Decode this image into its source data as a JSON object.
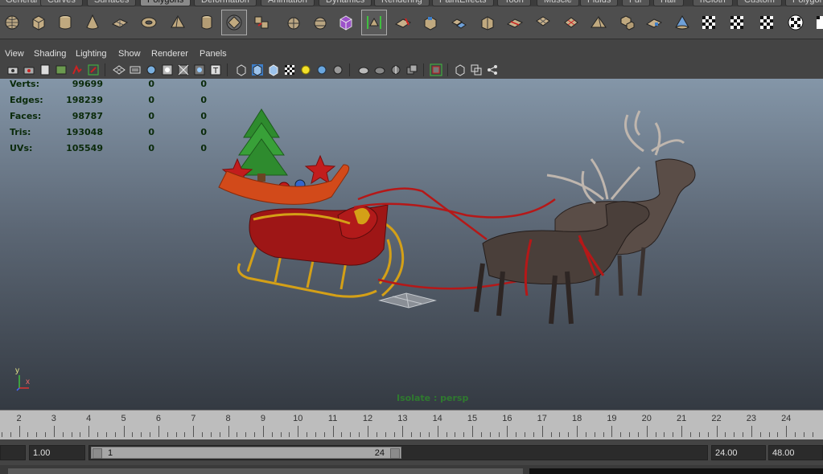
{
  "shelf_tabs": [
    {
      "label": "General",
      "active": false
    },
    {
      "label": "Curves",
      "active": false
    },
    {
      "label": "Surfaces",
      "active": false
    },
    {
      "label": "Polygons",
      "active": true
    },
    {
      "label": "Deformation",
      "active": false
    },
    {
      "label": "Animation",
      "active": false
    },
    {
      "label": "Dynamics",
      "active": false
    },
    {
      "label": "Rendering",
      "active": false
    },
    {
      "label": "PaintEffects",
      "active": false
    },
    {
      "label": "Toon",
      "active": false
    },
    {
      "label": "Muscle",
      "active": false
    },
    {
      "label": "Fluids",
      "active": false
    },
    {
      "label": "Fur",
      "active": false
    },
    {
      "label": "Hair",
      "active": false
    },
    {
      "label": "nCloth",
      "active": false
    },
    {
      "label": "Custom",
      "active": false
    },
    {
      "label": "Polygons",
      "active": false
    }
  ],
  "shelf_icons": [
    "poly-sphere-icon",
    "poly-cube-icon",
    "poly-cylinder-icon",
    "poly-cone-icon",
    "poly-plane-icon",
    "poly-torus-icon",
    "poly-pyramid-icon",
    "poly-pipe-icon",
    "smooth-proxy-icon",
    "combine-icon",
    "separate-icon",
    "extract-icon",
    "mirror-icon",
    "selected-object-icon",
    "bevel-icon",
    "extrude-icon",
    "bridge-icon",
    "append-icon",
    "split-polygon-icon",
    "insert-edge-loop-icon",
    "offset-edge-loop-icon",
    "sculpt-icon",
    "smooth-icon",
    "triangulate-icon",
    "quadrangulate-icon",
    "reduce-icon",
    "cleanup-icon",
    "fill-hole-icon",
    "planar-mapping-icon",
    "checker-uv-1-icon",
    "checker-uv-2-icon",
    "checker-uv-3-icon",
    "checker-uv-4-icon"
  ],
  "menu": [
    "View",
    "Shading",
    "Lighting",
    "Show",
    "Renderer",
    "Panels"
  ],
  "toolbar_icons": [
    "camera-select-icon",
    "camera-attr-icon",
    "bookmark-icon",
    "image-plane-icon",
    "two-d-pan-icon",
    "grease-pencil-icon",
    "grid-icon",
    "film-gate-icon",
    "resolution-gate-icon",
    "gate-mask-icon",
    "field-chart-icon",
    "safe-action-icon",
    "safe-title-icon",
    "wireframe-icon",
    "smooth-shade-icon",
    "wireframe-on-shaded-icon",
    "textured-icon",
    "use-all-lights-icon",
    "shadows-icon",
    "ambient-occlusion-icon",
    "xray-icon",
    "xray-joints-icon",
    "xray-components-icon",
    "isolate-select-icon",
    "backface-icon",
    "default-material-icon",
    "symmetry-icon"
  ],
  "hud": [
    {
      "label": "Verts:",
      "v1": "99699",
      "v2": "0",
      "v3": "0"
    },
    {
      "label": "Edges:",
      "v1": "198239",
      "v2": "0",
      "v3": "0"
    },
    {
      "label": "Faces:",
      "v1": "98787",
      "v2": "0",
      "v3": "0"
    },
    {
      "label": "Tris:",
      "v1": "193048",
      "v2": "0",
      "v3": "0"
    },
    {
      "label": "UVs:",
      "v1": "105549",
      "v2": "0",
      "v3": "0"
    }
  ],
  "axis": {
    "y": "y",
    "x": "x"
  },
  "isolate_text": "Isolate : persp",
  "timeline": {
    "labels": [
      "2",
      "3",
      "4",
      "5",
      "6",
      "7",
      "8",
      "9",
      "10",
      "11",
      "12",
      "13",
      "14",
      "15",
      "16",
      "17",
      "18",
      "19",
      "20",
      "21",
      "22",
      "23",
      "24"
    ]
  },
  "range": {
    "start_time": "",
    "playback_start": "1.00",
    "slider_start": "1",
    "slider_end": "24",
    "playback_end": "24.00",
    "end_time": "48.00"
  },
  "colors": {
    "viewport_top": "#8496a8",
    "viewport_bottom": "#343a42",
    "hud_text": "#0a2a0a",
    "isolate_text": "#2f7a2f",
    "sleigh_red": "#b11a1a",
    "sleigh_gold": "#d4a017",
    "tree_green": "#2e8b2e",
    "deer_brown": "#4a3f3a"
  }
}
